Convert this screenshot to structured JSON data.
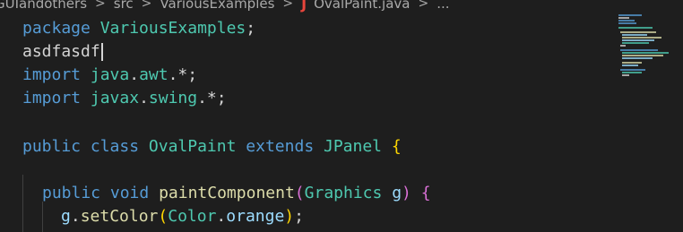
{
  "breadcrumb": {
    "items": [
      "GUIandothers",
      "src",
      "VariousExamples"
    ],
    "file_icon": "J",
    "file": "OvalPaint.java",
    "ellipsis": "..."
  },
  "code": {
    "line1": {
      "kw": "package",
      "name": "VariousExamples",
      "end": ";"
    },
    "line2": {
      "text": "asdfasdf"
    },
    "line3": {
      "kw": "import",
      "pkg": "java",
      "dot": ".",
      "sub": "awt",
      "rest": ".*;"
    },
    "line4": {
      "kw": "import",
      "pkg": "javax",
      "dot": ".",
      "sub": "swing",
      "rest": ".*;"
    },
    "line6": {
      "kw1": "public",
      "kw2": "class",
      "cls": "OvalPaint",
      "kw3": "extends",
      "parent": "JPanel",
      "brace": "{"
    },
    "line8": {
      "kw1": "public",
      "kw2": "void",
      "fn": "paintComponent",
      "open": "(",
      "type": "Graphics",
      "param": "g",
      "close": ")",
      "brace": "{"
    },
    "line9": {
      "obj": "g",
      "dot": ".",
      "fn": "setColor",
      "open": "(",
      "type": "Color",
      "dot2": ".",
      "field": "orange",
      "close": ")",
      "end": ";"
    }
  },
  "colors": {
    "background": "#1e1e1e",
    "keyword": "#569cd6",
    "type": "#4ec9b0",
    "function": "#dcdcaa",
    "variable": "#9cdcfe",
    "java_icon": "#e8453c"
  }
}
